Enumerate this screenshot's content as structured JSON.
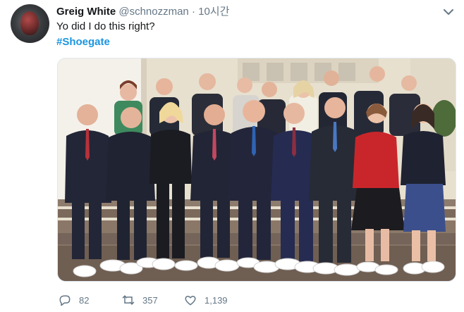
{
  "tweet": {
    "author_name": "Greig White",
    "author_handle": "@schnozzman",
    "separator": "·",
    "time": "10시간",
    "text": "Yo did I do this right?",
    "hashtag": "#Shoegate"
  },
  "actions": {
    "reply_count": "82",
    "retweet_count": "357",
    "like_count": "1,139"
  },
  "icons": {
    "menu": "chevron-down-icon",
    "reply": "reply-icon",
    "retweet": "retweet-icon",
    "like": "heart-icon"
  },
  "colors": {
    "hashtag": "#1b95e0",
    "secondary_text": "#657786",
    "primary_text": "#14171a"
  }
}
